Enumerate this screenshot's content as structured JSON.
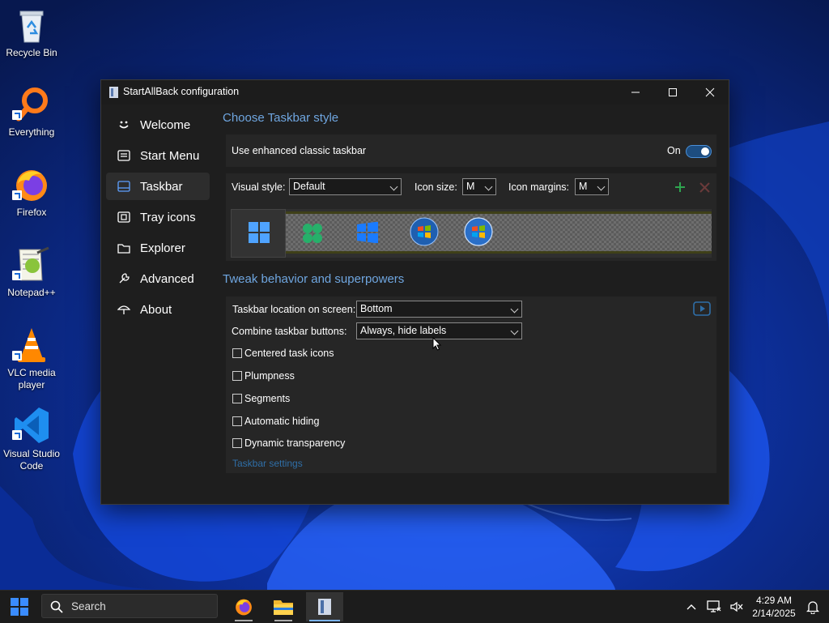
{
  "desktop": {
    "icons": [
      {
        "label": "Recycle Bin"
      },
      {
        "label": "Everything"
      },
      {
        "label": "Firefox"
      },
      {
        "label": "Notepad++"
      },
      {
        "label": "VLC media player"
      },
      {
        "label": "Visual Studio Code"
      }
    ]
  },
  "window": {
    "title": "StartAllBack configuration",
    "sidebar": [
      {
        "label": "Welcome",
        "icon": "smiley-icon"
      },
      {
        "label": "Start Menu",
        "icon": "start-menu-icon"
      },
      {
        "label": "Taskbar",
        "icon": "taskbar-icon",
        "active": true
      },
      {
        "label": "Tray icons",
        "icon": "tray-icon"
      },
      {
        "label": "Explorer",
        "icon": "folder-icon"
      },
      {
        "label": "Advanced",
        "icon": "wrench-icon"
      },
      {
        "label": "About",
        "icon": "umbrella-icon"
      }
    ],
    "style_section": {
      "title": "Choose Taskbar style",
      "enhanced_label": "Use enhanced classic taskbar",
      "toggle_state": "On",
      "visual_style_label": "Visual style:",
      "visual_style_value": "Default",
      "icon_size_label": "Icon size:",
      "icon_size_value": "M",
      "icon_margins_label": "Icon margins:",
      "icon_margins_value": "M"
    },
    "behavior_section": {
      "title": "Tweak behavior and superpowers",
      "location_label": "Taskbar location on screen:",
      "location_value": "Bottom",
      "combine_label": "Combine taskbar buttons:",
      "combine_value": "Always, hide labels",
      "checkboxes": [
        {
          "label": "Centered task icons",
          "checked": false
        },
        {
          "label": "Plumpness",
          "checked": false
        },
        {
          "label": "Segments",
          "checked": false
        },
        {
          "label": "Automatic hiding",
          "checked": false
        },
        {
          "label": "Dynamic transparency",
          "checked": false
        }
      ],
      "settings_link": "Taskbar settings"
    }
  },
  "taskbar": {
    "search_label": "Search",
    "time": "4:29 AM",
    "date": "2/14/2025"
  },
  "colors": {
    "accent": "#6fa6e0",
    "window_bg": "#1e1e1e",
    "panel_bg": "#262626",
    "taskbar_bg": "#1c1c1c"
  }
}
